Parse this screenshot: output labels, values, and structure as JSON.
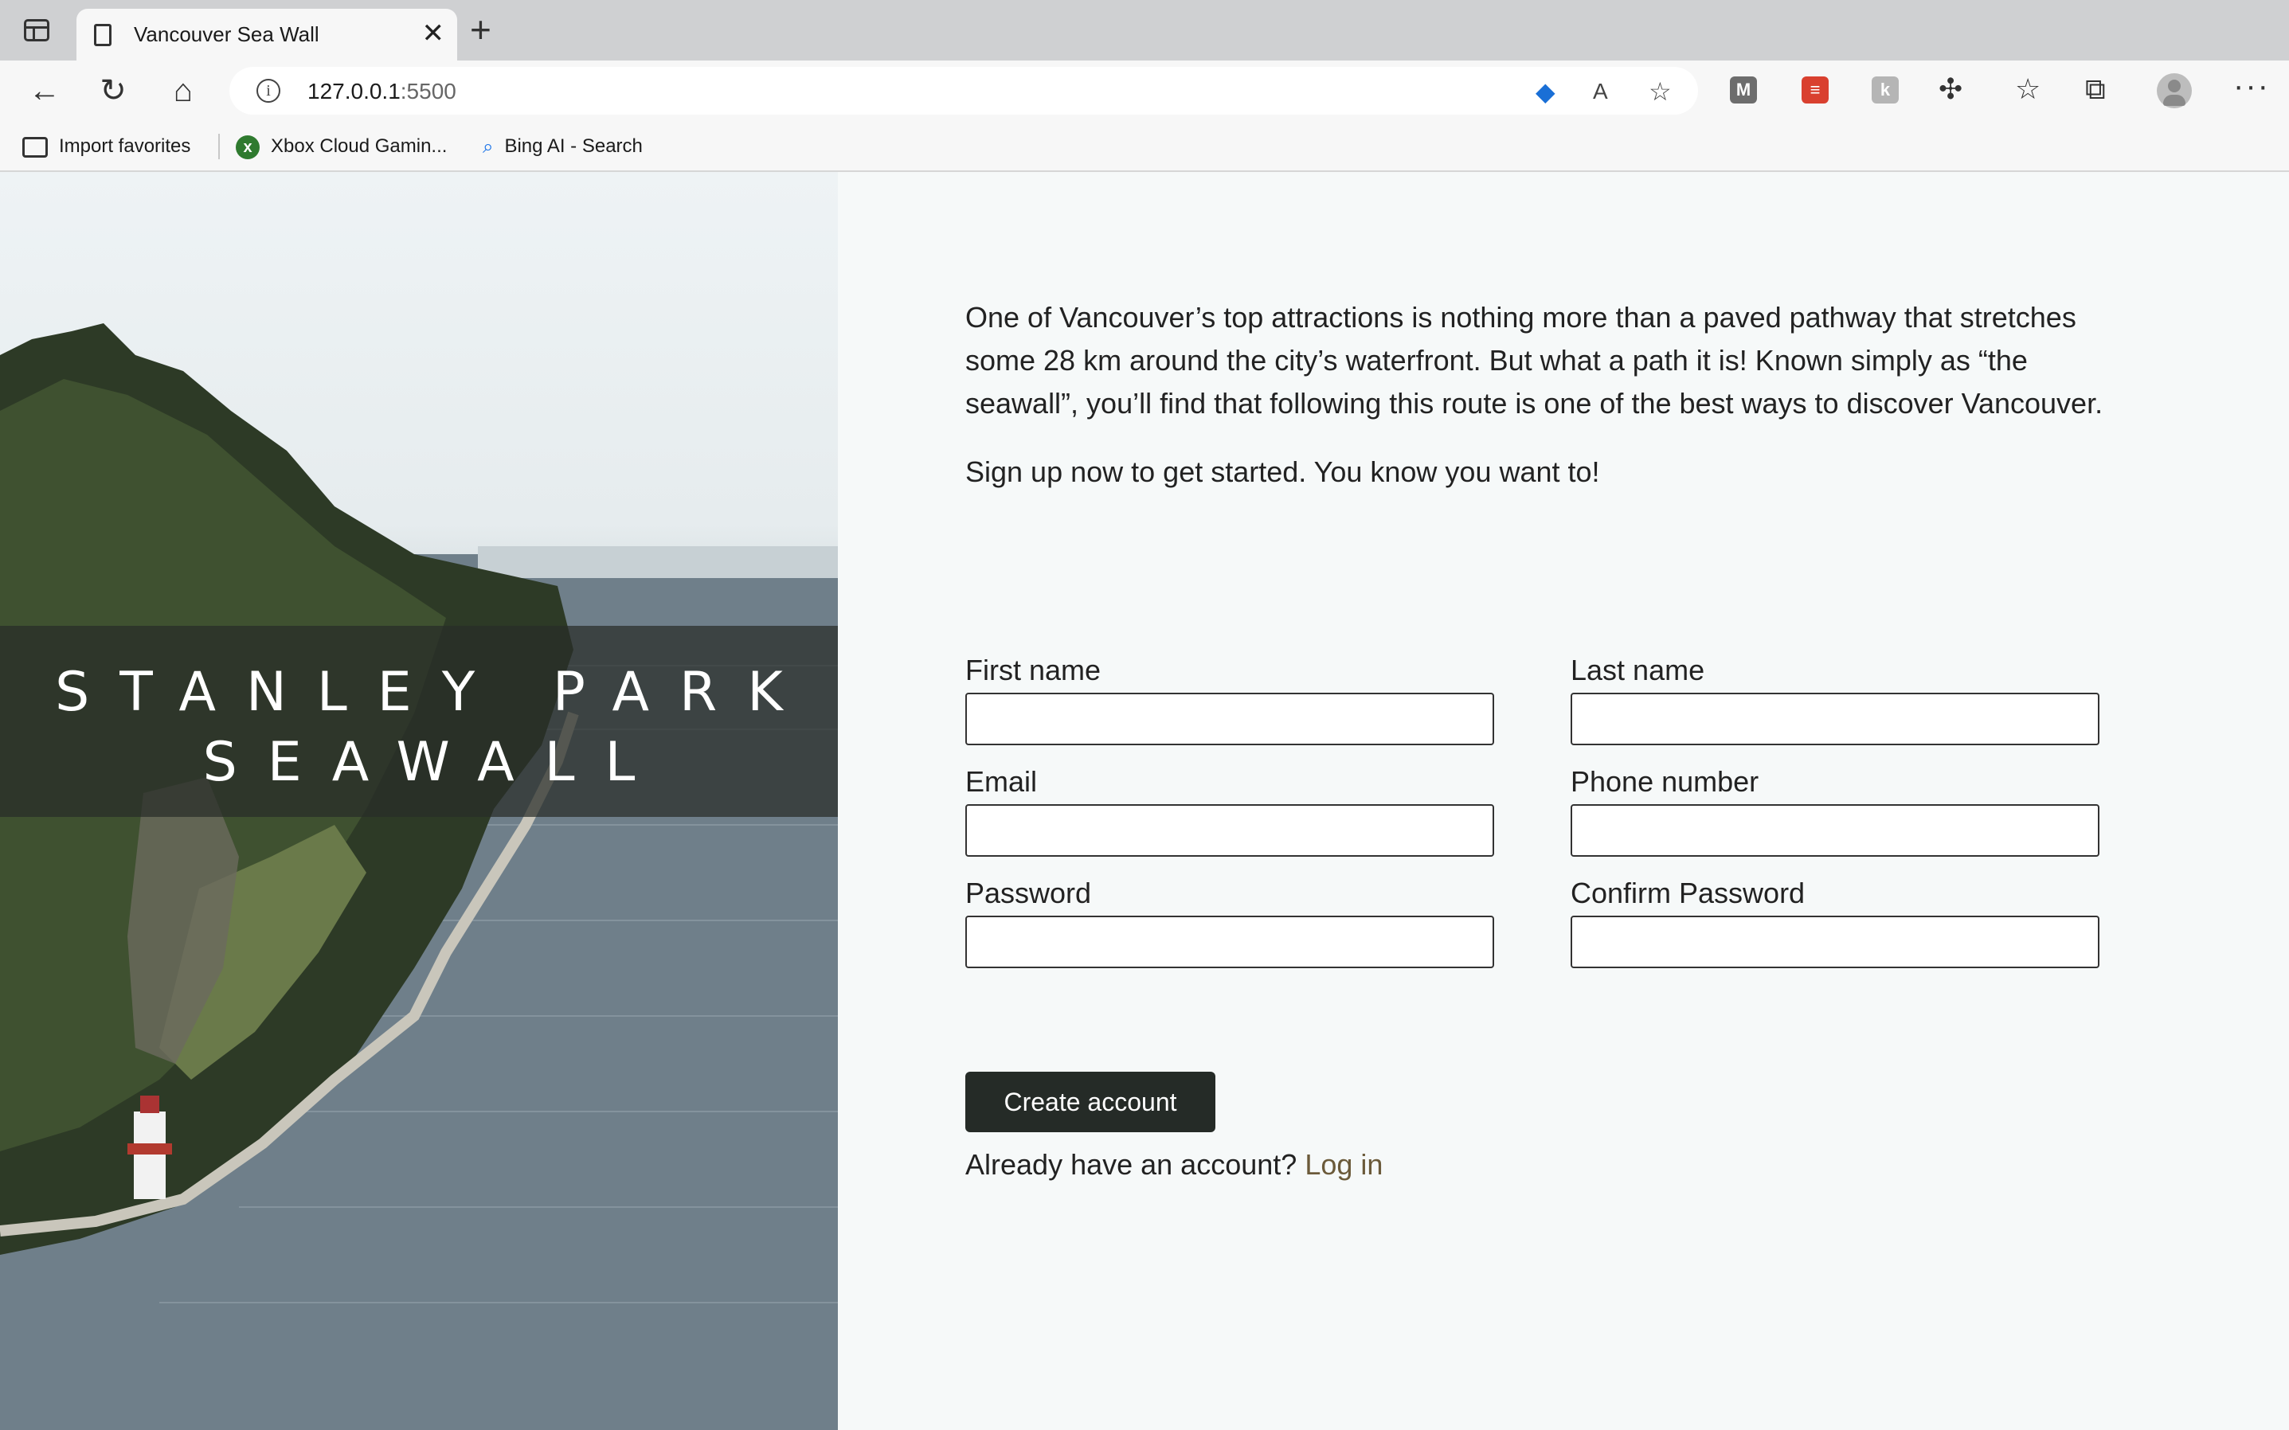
{
  "browser": {
    "tab_title": "Vancouver Sea Wall",
    "url_host": "127.0.0.1",
    "url_port": ":5500",
    "favorites": [
      {
        "label": "Import favorites",
        "icon": "import-folder-icon"
      },
      {
        "label": "Xbox Cloud Gamin...",
        "icon": "xbox-icon"
      },
      {
        "label": "Bing AI - Search",
        "icon": "bing-search-icon"
      }
    ]
  },
  "hero": {
    "title_line1": "STANLEY PARK",
    "title_line2": "SEAWALL"
  },
  "intro": {
    "paragraph": "One of Vancouver’s top attractions is nothing more than a paved pathway that stretches some 28 km around the city’s waterfront. But what a path it is! Known simply as “the seawall”, you’ll find that following this route is one of the best ways to discover Vancouver.",
    "cta": "Sign up now to get started. You know you want to!"
  },
  "form": {
    "first_name_label": "First name",
    "last_name_label": "Last name",
    "email_label": "Email",
    "phone_label": "Phone number",
    "password_label": "Password",
    "confirm_password_label": "Confirm Password",
    "submit_label": "Create account",
    "login_prompt": "Already have an account?",
    "login_link": "Log in"
  },
  "colors": {
    "page_background": "#f6f9f9",
    "button_background": "#252b27",
    "link_color": "#6b5a3a"
  }
}
